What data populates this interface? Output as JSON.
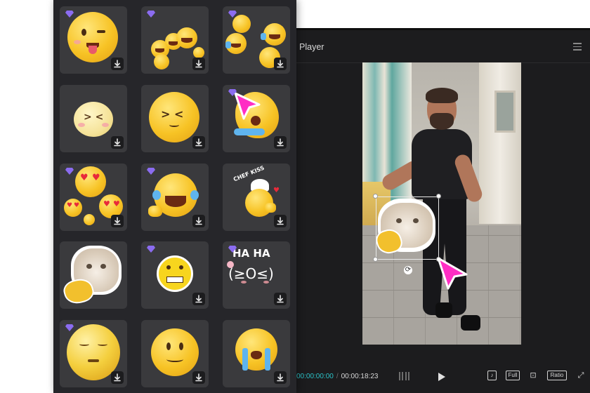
{
  "player": {
    "title": "Player",
    "time_current": "00:00:00:00",
    "time_total": "00:00:18:23",
    "controls": {
      "tiktok": "♪",
      "full": "Full",
      "fit": "⊡",
      "ratio": "Ratio",
      "expand": "⤢"
    }
  },
  "stickers": {
    "items": [
      {
        "name": "wink-tongue",
        "premium": true
      },
      {
        "name": "laughing-pile",
        "premium": true
      },
      {
        "name": "crying-laughing-group",
        "premium": true
      },
      {
        "name": "happy-blushing",
        "premium": false
      },
      {
        "name": "smiling-closed-eyes",
        "premium": false
      },
      {
        "name": "crying-hand",
        "premium": true
      },
      {
        "name": "heart-eyes-group",
        "premium": true
      },
      {
        "name": "laughing-tears",
        "premium": true
      },
      {
        "name": "chef-kiss",
        "premium": false
      },
      {
        "name": "cat-phone",
        "premium": false
      },
      {
        "name": "grimacing",
        "premium": true
      },
      {
        "name": "ha-ha",
        "premium": true
      },
      {
        "name": "relieved",
        "premium": true
      },
      {
        "name": "slight-smile",
        "premium": false
      },
      {
        "name": "loudly-crying",
        "premium": false
      }
    ],
    "texts": {
      "chef_kiss": "CHEF KISS",
      "ha_ha": "HA HA",
      "kaomoji": "(≥O≤)"
    }
  },
  "colors": {
    "accent": "#2bc3c9",
    "cursor": "#ff2ec4",
    "premium_gem": "#8b6cf0",
    "panel": "#26262a",
    "cell": "#3a3a3d"
  }
}
